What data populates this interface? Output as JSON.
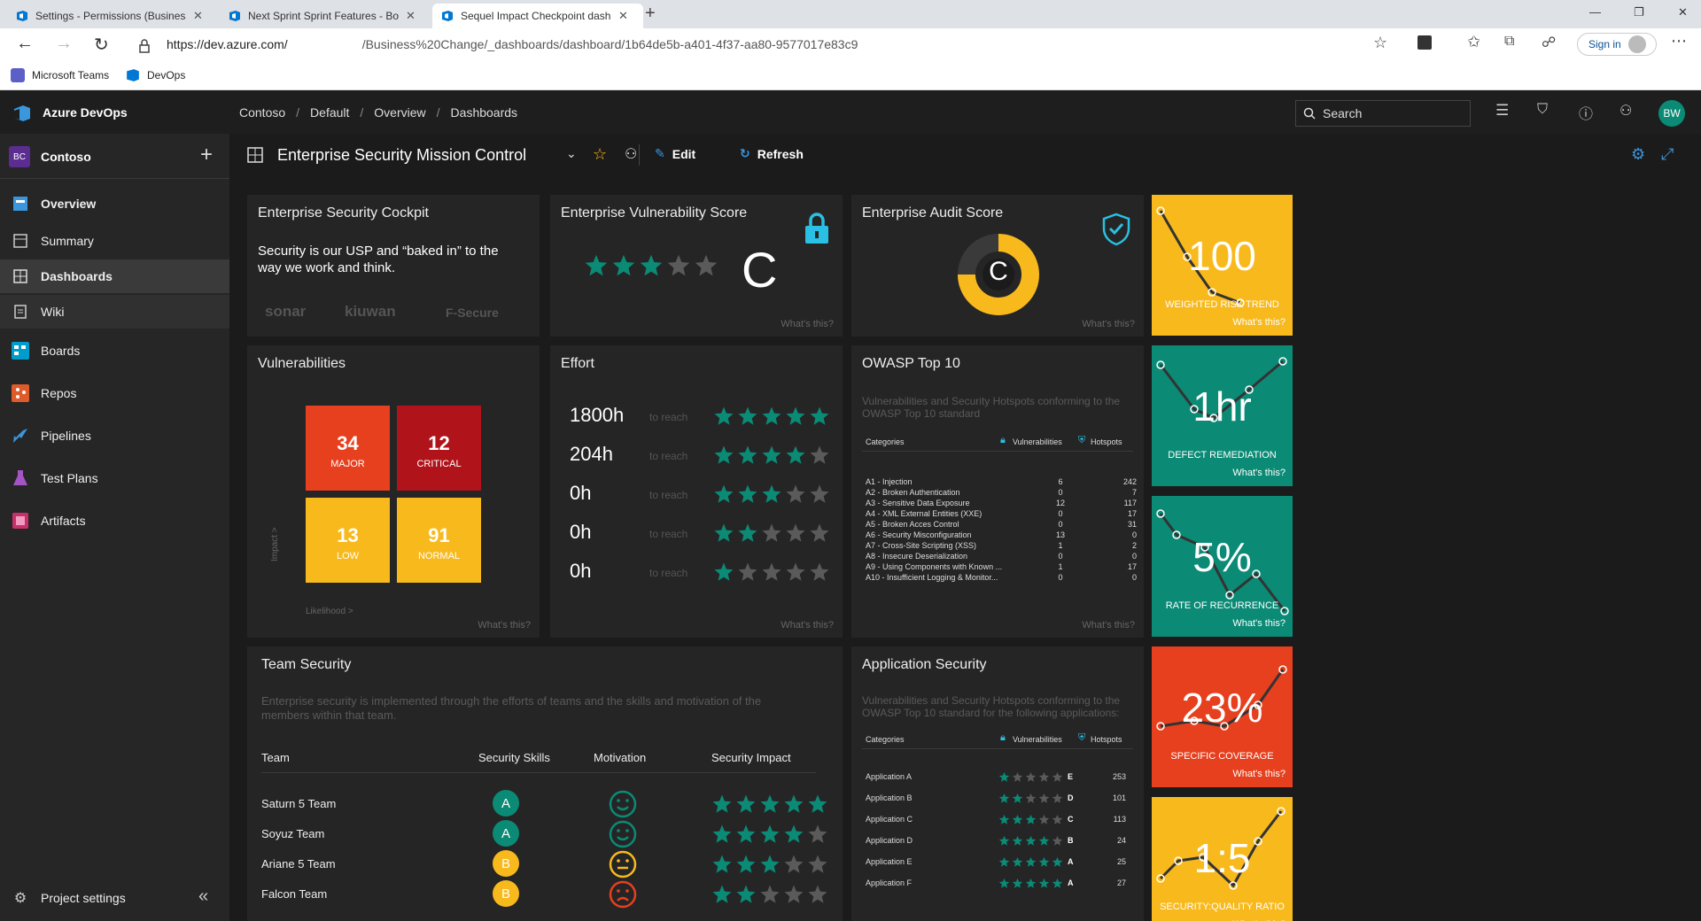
{
  "browser": {
    "tabs": [
      "Settings - Permissions (Business C...",
      "Next Sprint Sprint Features - Boa...",
      "Sequel Impact Checkpoint dashb..."
    ],
    "url_host": "https://dev.azure.com/",
    "url_path": "/Business%20Change/_dashboards/dashboard/1b64de5b-a401-4f37-aa80-9577017e83c9",
    "signin": "Sign in",
    "bookmarks": [
      "Microsoft Teams",
      "DevOps"
    ]
  },
  "header": {
    "brand": "Azure DevOps",
    "breadcrumb": [
      "Contoso",
      "Default",
      "Overview",
      "Dashboards"
    ],
    "search_label": "Search",
    "avatar": "BW"
  },
  "sidebar": {
    "org_initials": "BC",
    "org": "Contoso",
    "items": [
      {
        "label": "Overview",
        "icon": "overview-icon"
      },
      {
        "label": "Summary",
        "icon": "summary-icon"
      },
      {
        "label": "Dashboards",
        "icon": "dashboards-icon"
      },
      {
        "label": "Wiki",
        "icon": "wiki-icon"
      },
      {
        "label": "Boards",
        "icon": "boards-icon"
      },
      {
        "label": "Repos",
        "icon": "repos-icon"
      },
      {
        "label": "Pipelines",
        "icon": "pipelines-icon"
      },
      {
        "label": "Test Plans",
        "icon": "test-plans-icon"
      },
      {
        "label": "Artifacts",
        "icon": "artifacts-icon"
      }
    ],
    "settings": "Project settings"
  },
  "toolbar": {
    "title": "Enterprise Security Mission Control",
    "edit": "Edit",
    "refresh": "Refresh"
  },
  "whats": "What's this?",
  "cockpit": {
    "title": "Enterprise Security Cockpit",
    "text": "Security is our USP and “baked in” to the way we work and think.",
    "logos": [
      "sonar",
      "kiuwan",
      "F-Secure"
    ]
  },
  "vuln_score": {
    "title": "Enterprise Vulnerability Score",
    "grade": "C",
    "stars": 3
  },
  "audit_score": {
    "title": "Enterprise Audit Score",
    "grade": "C",
    "fill": 0.75
  },
  "kpis": [
    {
      "value": "100",
      "label": "WEIGHTED RISK TREND",
      "color": "#f8b91d"
    },
    {
      "value": "1hr",
      "label": "DEFECT REMEDIATION",
      "color": "#0b8a75"
    },
    {
      "value": "5%",
      "label": "RATE OF RECURRENCE",
      "color": "#0b8a75"
    },
    {
      "value": "23%",
      "label": "SPECIFIC COVERAGE",
      "color": "#e6401e"
    },
    {
      "value": "1:5",
      "label": "SECURITY:QUALITY RATIO",
      "color": "#f8b91d"
    }
  ],
  "vulnerabilities": {
    "title": "Vulnerabilities",
    "cells": [
      {
        "value": "34",
        "label": "MAJOR",
        "color": "#e6401e"
      },
      {
        "value": "12",
        "label": "CRITICAL",
        "color": "#b0141a"
      },
      {
        "value": "13",
        "label": "LOW",
        "color": "#f8b91d"
      },
      {
        "value": "91",
        "label": "NORMAL",
        "color": "#f8b91d"
      }
    ],
    "y_axis": "Impact >",
    "x_axis": "Likelihood >"
  },
  "effort": {
    "title": "Effort",
    "to_reach": "to reach",
    "rows": [
      {
        "hours": "1800h",
        "stars": 5
      },
      {
        "hours": "204h",
        "stars": 4
      },
      {
        "hours": "0h",
        "stars": 3
      },
      {
        "hours": "0h",
        "stars": 2
      },
      {
        "hours": "0h",
        "stars": 1
      }
    ]
  },
  "owasp": {
    "title": "OWASP Top 10",
    "desc": "Vulnerabilities and Security Hotspots conforming to the OWASP Top 10 standard",
    "col_categories": "Categories",
    "col_vuln": "Vulnerabilities",
    "col_hot": "Hotspots",
    "rows": [
      {
        "cat": "A1 - Injection",
        "v": "6",
        "h": "242"
      },
      {
        "cat": "A2 - Broken Authentication",
        "v": "0",
        "h": "7"
      },
      {
        "cat": "A3 - Sensitive Data Exposure",
        "v": "12",
        "h": "117"
      },
      {
        "cat": "A4 - XML External Entities (XXE)",
        "v": "0",
        "h": "17"
      },
      {
        "cat": "A5 - Broken Acces Control",
        "v": "0",
        "h": "31"
      },
      {
        "cat": "A6 - Security Misconfiguration",
        "v": "13",
        "h": "0"
      },
      {
        "cat": "A7 - Cross-Site Scripting (XSS)",
        "v": "1",
        "h": "2"
      },
      {
        "cat": "A8 - Insecure Deserialization",
        "v": "0",
        "h": "0"
      },
      {
        "cat": "A9 - Using Components with Known ...",
        "v": "1",
        "h": "17"
      },
      {
        "cat": "A10 - Insufficient Logging & Monitor...",
        "v": "0",
        "h": "0"
      }
    ]
  },
  "team": {
    "title": "Team Security",
    "desc": "Enterprise security is implemented through the efforts of teams and the skills and motivation of the members within that team.",
    "cols": [
      "Team",
      "Security Skills",
      "Motivation",
      "Security Impact"
    ],
    "rows": [
      {
        "name": "Saturn 5 Team",
        "skill": "A",
        "mood": "happy",
        "stars": 5
      },
      {
        "name": "Soyuz Team",
        "skill": "A",
        "mood": "happy",
        "stars": 4
      },
      {
        "name": "Ariane 5 Team",
        "skill": "B",
        "mood": "neutral",
        "stars": 3
      },
      {
        "name": "Falcon Team",
        "skill": "B",
        "mood": "sad",
        "stars": 2
      }
    ]
  },
  "app_sec": {
    "title": "Application Security",
    "desc": "Vulnerabilities and Security Hotspots conforming to the OWASP Top 10 standard for the following applications:",
    "col_categories": "Categories",
    "col_vuln": "Vulnerabilities",
    "col_hot": "Hotspots",
    "rows": [
      {
        "name": "Application A",
        "stars": 1,
        "grade": "E",
        "hot": "253"
      },
      {
        "name": "Application B",
        "stars": 2,
        "grade": "D",
        "hot": "101"
      },
      {
        "name": "Application C",
        "stars": 3,
        "grade": "C",
        "hot": "113"
      },
      {
        "name": "Application D",
        "stars": 4,
        "grade": "B",
        "hot": "24"
      },
      {
        "name": "Application E",
        "stars": 5,
        "grade": "A",
        "hot": "25"
      },
      {
        "name": "Application F",
        "stars": 5,
        "grade": "A",
        "hot": "27"
      }
    ]
  }
}
